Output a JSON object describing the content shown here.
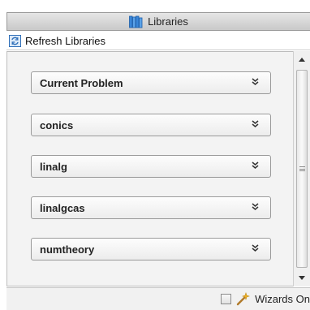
{
  "header": {
    "title": "Libraries",
    "icon": "libraries-icon"
  },
  "toolbar": {
    "refresh_label": "Refresh Libraries",
    "refresh_icon": "refresh-icon"
  },
  "libraries": [
    {
      "label": "Current Problem",
      "expander": "»"
    },
    {
      "label": "conics",
      "expander": "»"
    },
    {
      "label": "linalg",
      "expander": "»"
    },
    {
      "label": "linalgcas",
      "expander": "»"
    },
    {
      "label": "numtheory",
      "expander": "»"
    }
  ],
  "footer": {
    "wizards_label": "Wizards On",
    "wizards_checked": false,
    "wizards_icon": "wand-icon"
  },
  "colors": {
    "title_bar": "#d6d6d6",
    "content_bg": "#f3f3f3",
    "icon_blue": "#2f7fd4"
  }
}
